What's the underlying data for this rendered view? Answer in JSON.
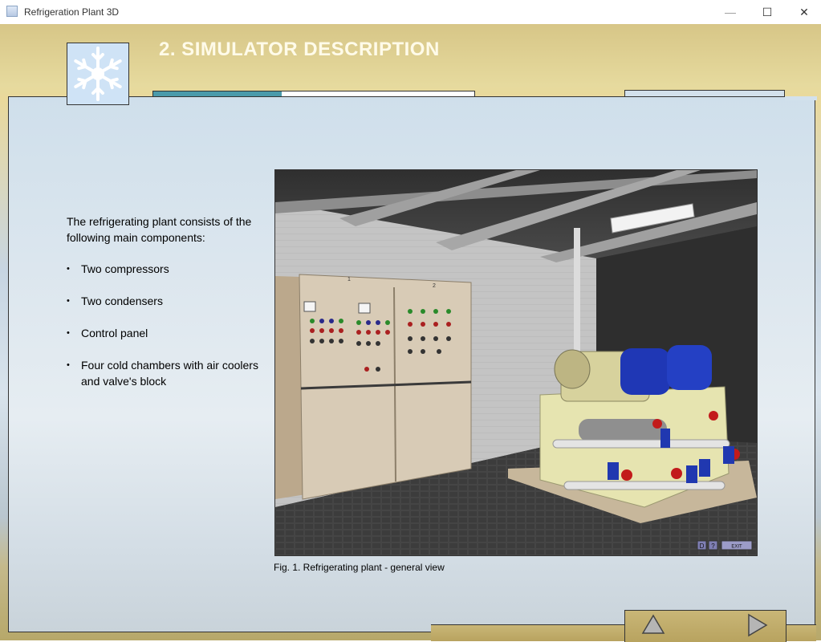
{
  "window": {
    "title": "Refrigeration Plant 3D",
    "minimize": "—",
    "maximize": "☐",
    "close": "✕"
  },
  "header": {
    "title": "2. SIMULATOR DESCRIPTION",
    "progress_fraction": 0.4
  },
  "content": {
    "intro": "The refrigerating plant consists of the following main components:",
    "components": [
      "Two compressors",
      "Two condensers",
      "Control panel",
      "Four cold chambers with air coolers and valve's block"
    ]
  },
  "figure": {
    "caption": "Fig. 1. Refrigerating plant - general view",
    "panel_left_label": "1",
    "panel_right_label": "2",
    "btn_d": "D",
    "btn_help": "?",
    "btn_exit": "EXIT"
  },
  "nav": {
    "up_icon": "up-triangle-icon",
    "next_icon": "right-triangle-icon"
  },
  "colors": {
    "title": "#fffbe9",
    "progress": "#4a9aaa",
    "panel": "#dfe8ef"
  }
}
